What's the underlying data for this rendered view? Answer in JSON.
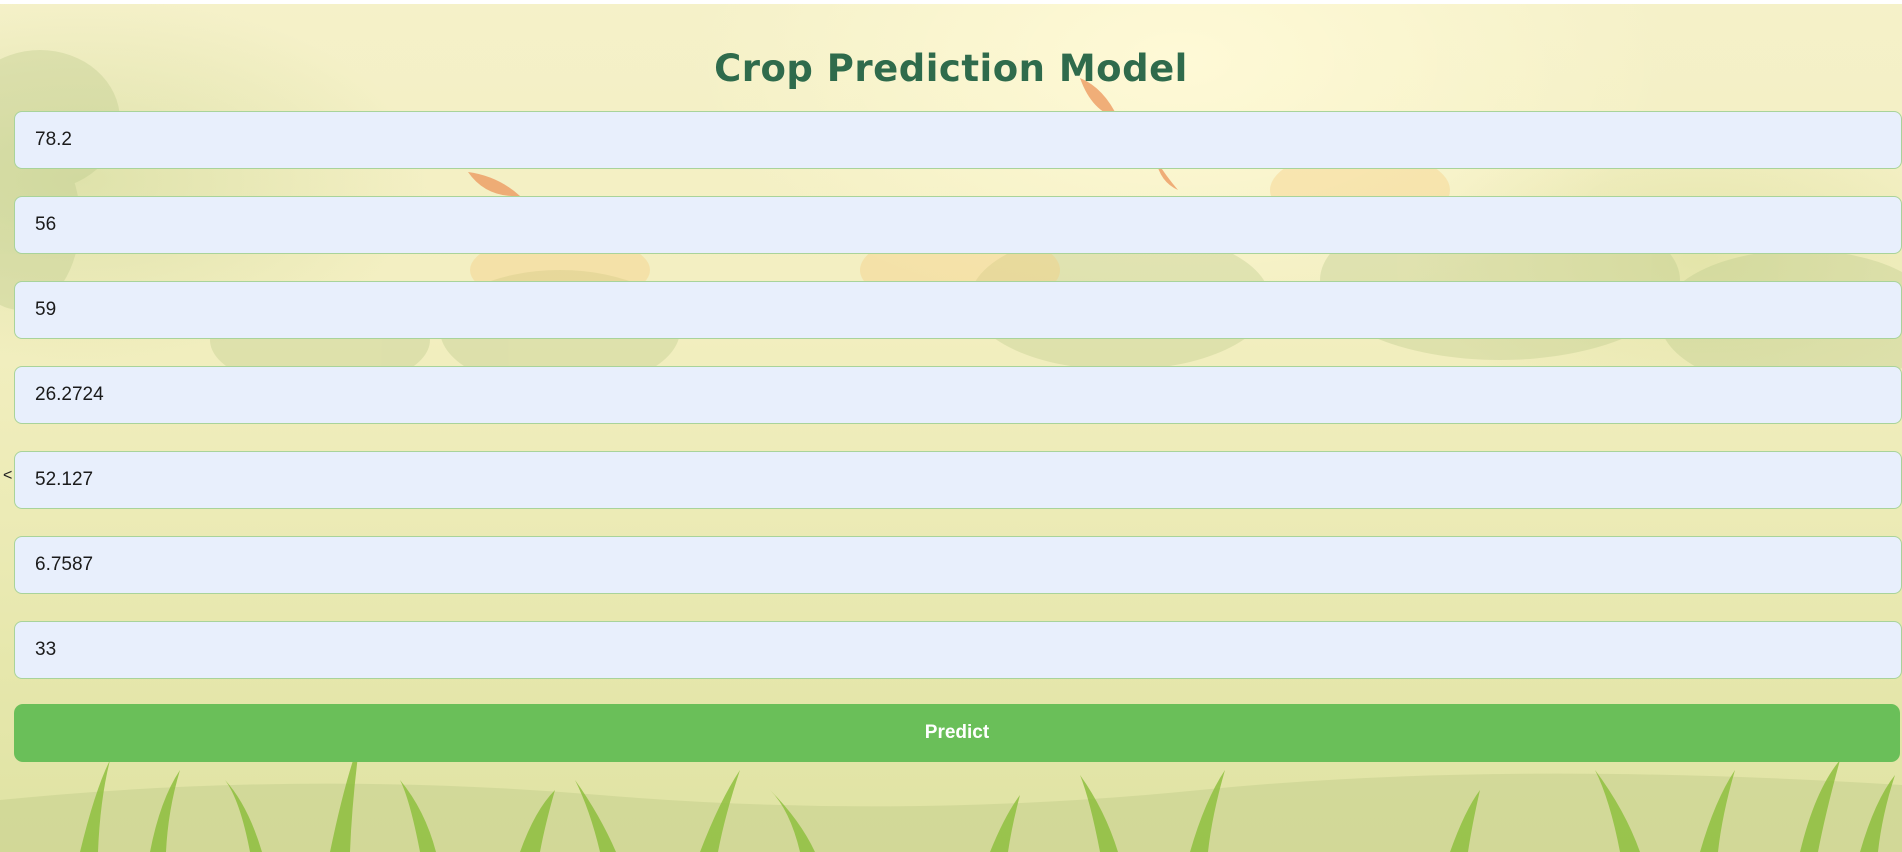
{
  "page": {
    "title": "Crop Prediction Model",
    "stray_char": "<"
  },
  "form": {
    "fields": [
      {
        "value": "78.2"
      },
      {
        "value": "56"
      },
      {
        "value": "59"
      },
      {
        "value": "26.2724"
      },
      {
        "value": "52.127"
      },
      {
        "value": "6.7587"
      },
      {
        "value": "33"
      }
    ],
    "predict_label": "Predict"
  },
  "colors": {
    "title": "#2f6b4c",
    "field_background": "#e8effc",
    "field_border": "#a9d39a",
    "button": "#6abf59",
    "button_text": "#ffffff"
  }
}
